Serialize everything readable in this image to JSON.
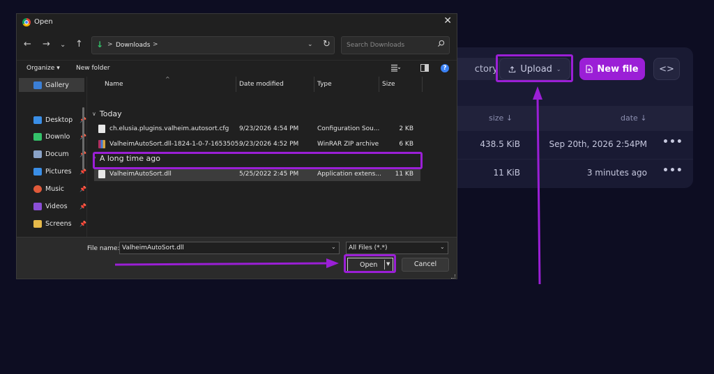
{
  "web": {
    "toolbar": {
      "directory_label": "ctory",
      "upload_label": "Upload",
      "new_file_label": "New file",
      "code_label": "<>"
    },
    "columns": {
      "size": "size",
      "size_sort": "↓",
      "date": "date",
      "date_sort": "↓"
    },
    "rows": [
      {
        "size": "438.5 KiB",
        "date": "Sep 20th, 2026 2:54PM",
        "more": "•••"
      },
      {
        "size": "11 KiB",
        "date": "3 minutes ago",
        "more": "•••"
      }
    ]
  },
  "dialog": {
    "title": "Open",
    "address": {
      "folder": "Downloads",
      "sep": ">"
    },
    "search_placeholder": "Search Downloads",
    "commands": {
      "organize": "Organize",
      "organize_caret": "▾",
      "new_folder": "New folder"
    },
    "sidebar": [
      {
        "label": "Gallery",
        "icon": "gallery-icon",
        "color": "#3b7fd6"
      },
      {
        "label": "Desktop",
        "icon": "desktop-icon",
        "color": "#3a8ee6"
      },
      {
        "label": "Downlo",
        "icon": "downloads-icon",
        "color": "#34c26a"
      },
      {
        "label": "Docum",
        "icon": "documents-icon",
        "color": "#8aa3c8"
      },
      {
        "label": "Pictures",
        "icon": "pictures-icon",
        "color": "#3a8ee6"
      },
      {
        "label": "Music",
        "icon": "music-icon",
        "color": "#e05a3a"
      },
      {
        "label": "Videos",
        "icon": "videos-icon",
        "color": "#8b4fd6"
      },
      {
        "label": "Screens",
        "icon": "folder-icon",
        "color": "#e5b94a"
      }
    ],
    "columns": {
      "name": "Name",
      "date": "Date modified",
      "type": "Type",
      "size": "Size"
    },
    "groups": {
      "today": "Today",
      "long_ago": "A long time ago"
    },
    "files": [
      {
        "name": "ch.elusia.plugins.valheim.autosort.cfg",
        "date": "9/23/2026 4:54 PM",
        "type": "Configuration Sou...",
        "size": "2 KB"
      },
      {
        "name": "ValheimAutoSort.dll-1824-1-0-7-1653505...",
        "date": "9/23/2026 4:52 PM",
        "type": "WinRAR ZIP archive",
        "size": "6 KB"
      },
      {
        "name": "ValheimAutoSort.dll",
        "date": "5/25/2022 2:45 PM",
        "type": "Application extens...",
        "size": "11 KB"
      }
    ],
    "footer": {
      "file_name_label": "File name:",
      "file_name_value": "ValheimAutoSort.dll",
      "file_type_value": "All Files (*.*)",
      "open_label": "Open",
      "cancel_label": "Cancel"
    }
  },
  "annotation_color": "#9b1fd6"
}
